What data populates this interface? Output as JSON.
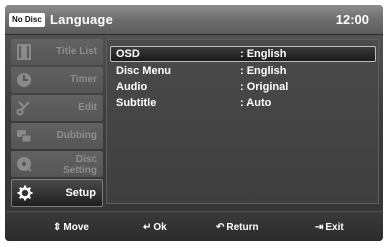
{
  "header": {
    "disc_status": "No Disc",
    "title": "Language",
    "time": "12:00"
  },
  "sidebar": {
    "items": [
      {
        "label": "Title List",
        "icon": "film-icon",
        "active": false
      },
      {
        "label": "Timer",
        "icon": "clock-icon",
        "active": false
      },
      {
        "label": "Edit",
        "icon": "scissors-icon",
        "active": false
      },
      {
        "label": "Dubbing",
        "icon": "dubbing-icon",
        "active": false
      },
      {
        "label": "Disc\nSetting",
        "icon": "disc-icon",
        "active": false
      },
      {
        "label": "Setup",
        "icon": "gear-icon",
        "active": true
      }
    ]
  },
  "settings": {
    "rows": [
      {
        "label": "OSD",
        "value": ": English",
        "selected": true
      },
      {
        "label": "Disc Menu",
        "value": ": English",
        "selected": false
      },
      {
        "label": "Audio",
        "value": ": Original",
        "selected": false
      },
      {
        "label": "Subtitle",
        "value": ": Auto",
        "selected": false
      }
    ]
  },
  "footer": {
    "move": {
      "icon": "updown-arrows-icon",
      "label": "Move"
    },
    "ok": {
      "icon": "enter-icon",
      "label": "Ok"
    },
    "return": {
      "icon": "return-icon",
      "label": "Return"
    },
    "exit": {
      "icon": "exit-icon",
      "label": "Exit"
    }
  }
}
